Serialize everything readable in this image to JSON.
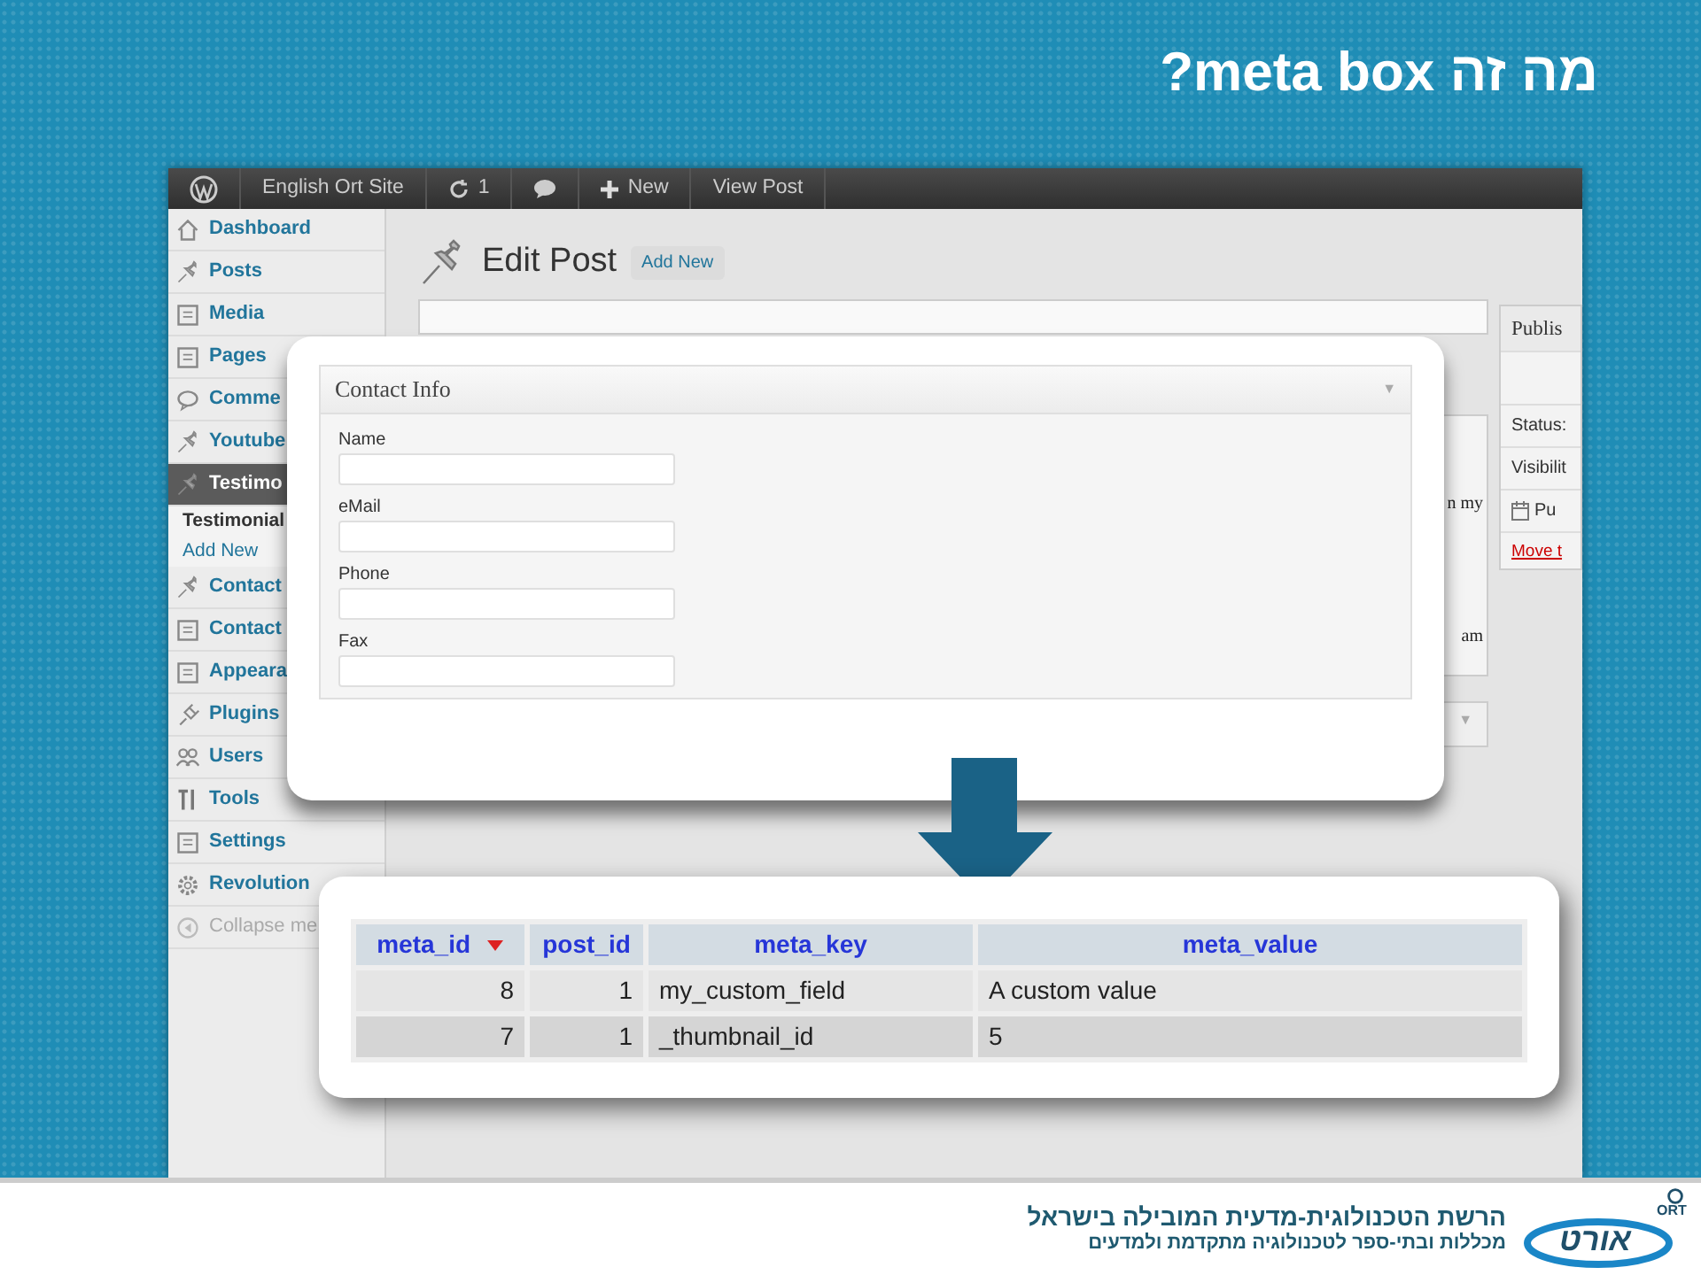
{
  "slide_title": "מה זה meta box?",
  "admin_bar": [
    {
      "kind": "logo"
    },
    {
      "kind": "site",
      "label": "English Ort Site"
    },
    {
      "kind": "updates",
      "label": "1"
    },
    {
      "kind": "comments"
    },
    {
      "kind": "new",
      "label": "New"
    },
    {
      "kind": "link",
      "label": "View Post"
    }
  ],
  "sidebar": {
    "items": [
      {
        "kind": "menu",
        "label": "Dashboard",
        "selected": false
      },
      {
        "kind": "menu",
        "label": "Posts",
        "selected": false
      },
      {
        "kind": "menu",
        "label": "Media",
        "selected": false
      },
      {
        "kind": "menu",
        "label": "Pages",
        "selected": false
      },
      {
        "kind": "menu",
        "label": "Comme",
        "selected": false
      },
      {
        "kind": "menu",
        "label": "Youtube",
        "selected": false
      },
      {
        "kind": "menu",
        "label": "Testimo",
        "selected": true
      },
      {
        "kind": "submenu",
        "label": "Testimonial",
        "selected": true
      },
      {
        "kind": "submenu",
        "label": "Add New",
        "selected": false
      },
      {
        "kind": "menu",
        "label": "Contact",
        "selected": false
      },
      {
        "kind": "menu",
        "label": "Contact",
        "selected": false
      },
      {
        "kind": "menu",
        "label": "Appeara",
        "selected": false
      },
      {
        "kind": "menu",
        "label": "Plugins",
        "selected": false
      },
      {
        "kind": "menu",
        "label": "Users",
        "selected": false
      },
      {
        "kind": "menu",
        "label": "Tools",
        "selected": false
      },
      {
        "kind": "menu",
        "label": "Settings",
        "selected": false
      },
      {
        "kind": "menu",
        "label": "Revolution",
        "selected": false
      },
      {
        "kind": "collapse",
        "label": "Collapse me",
        "selected": false
      }
    ]
  },
  "page_heading": {
    "title": "Edit Post",
    "add_new": "Add New"
  },
  "editor_fragments": [
    "n my",
    "am"
  ],
  "lower_box_toggle": "▼",
  "publish_box": {
    "title": "Publis",
    "status": "Status:",
    "visibility": "Visibilit",
    "publish_date": "Pu",
    "trash_link": "Move t"
  },
  "contact_info": {
    "title": "Contact Info",
    "toggle": "▼",
    "fields": [
      {
        "label": "Name"
      },
      {
        "label": "eMail"
      },
      {
        "label": "Phone"
      },
      {
        "label": "Fax"
      }
    ]
  },
  "table": {
    "columns": [
      {
        "label": "meta_id",
        "sorted": true
      },
      {
        "label": "post_id",
        "sorted": false
      },
      {
        "label": "meta_key",
        "sorted": false
      },
      {
        "label": "meta_value",
        "sorted": false
      }
    ],
    "rows": [
      [
        "8",
        "1",
        "my_custom_field",
        "A custom value"
      ],
      [
        "7",
        "1",
        "_thumbnail_id",
        "5"
      ]
    ]
  },
  "footer": {
    "logo_latin": "ORT",
    "logo_hebrew": "אורט",
    "tagline": "הרשת הטכנולוגית-מדעית המובילה בישראל",
    "subtitle": "מכללות ובתי-ספר לטכנולוגיה מתקדמת ולמדעים"
  }
}
